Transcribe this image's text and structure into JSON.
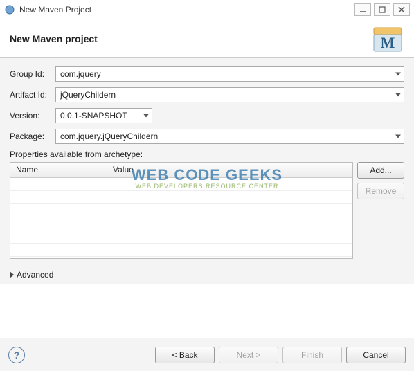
{
  "window": {
    "title": "New Maven Project"
  },
  "banner": {
    "heading": "New Maven project"
  },
  "labels": {
    "groupId": "Group Id:",
    "artifactId": "Artifact Id:",
    "version": "Version:",
    "package": "Package:",
    "propsSection": "Properties available from archetype:",
    "colName": "Name",
    "colValue": "Value",
    "advanced": "Advanced"
  },
  "values": {
    "groupId": "com.jquery",
    "artifactId": "jQueryChildern",
    "version": "0.0.1-SNAPSHOT",
    "package": "com.jquery.jQueryChildern"
  },
  "buttons": {
    "add": "Add...",
    "remove": "Remove",
    "back": "< Back",
    "next": "Next >",
    "finish": "Finish",
    "cancel": "Cancel"
  },
  "watermark": {
    "line1": "WEB CODE GEEKS",
    "line2": "WEB DEVELOPERS RESOURCE CENTER"
  }
}
